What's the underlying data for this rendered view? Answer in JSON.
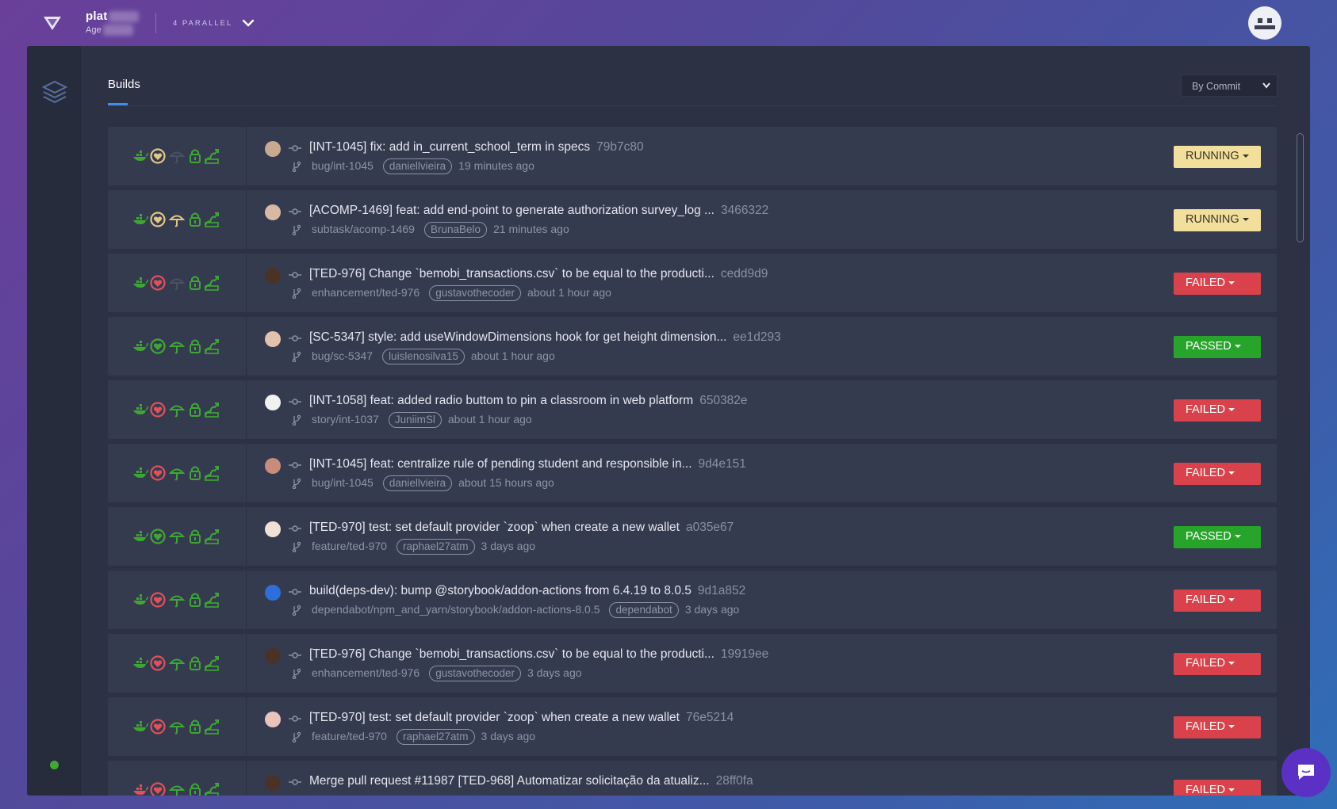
{
  "project": {
    "name": "plat",
    "subtitle": "Age",
    "parallel": "4 PARALLEL"
  },
  "tabs": {
    "builds": "Builds"
  },
  "sort": {
    "selected": "By Commit"
  },
  "colors": {
    "running": "#f2df9c",
    "failed": "#d9424a",
    "passed": "#27a52a",
    "icon_ok": "#3ea734",
    "icon_fail": "#e0515a",
    "icon_pending": "#e0c784"
  },
  "builds": [
    {
      "title": "[INT-1045] fix: add in_current_school_term in specs",
      "sha": "79b7c80",
      "branch": "bug/int-1045",
      "user": "daniellvieira",
      "time": "19 minutes ago",
      "status": "RUNNING",
      "icons": [
        "ok",
        "pending",
        "dim",
        "ok",
        "ok"
      ]
    },
    {
      "title": "[ACOMP-1469] feat: add end-point to generate authorization survey_log ...",
      "sha": "3466322",
      "branch": "subtask/acomp-1469",
      "user": "BrunaBelo",
      "time": "21 minutes ago",
      "status": "RUNNING",
      "icons": [
        "ok",
        "pending",
        "pending",
        "ok",
        "ok"
      ]
    },
    {
      "title": "[TED-976] Change `bemobi_transactions.csv` to be equal to the producti...",
      "sha": "cedd9d9",
      "branch": "enhancement/ted-976",
      "user": "gustavothecoder",
      "time": "about 1 hour ago",
      "status": "FAILED",
      "icons": [
        "ok",
        "fail",
        "dim",
        "ok",
        "ok"
      ]
    },
    {
      "title": "[SC-5347] style: add useWindowDimensions hook for get height dimension...",
      "sha": "ee1d293",
      "branch": "bug/sc-5347",
      "user": "luislenosilva15",
      "time": "about 1 hour ago",
      "status": "PASSED",
      "icons": [
        "ok",
        "ok",
        "ok",
        "ok",
        "ok"
      ]
    },
    {
      "title": "[INT-1058] feat: added radio buttom to pin a classroom in web platform",
      "sha": "650382e",
      "branch": "story/int-1037",
      "user": "JuniimSl",
      "time": "about 1 hour ago",
      "status": "FAILED",
      "icons": [
        "ok",
        "fail",
        "ok",
        "ok",
        "ok"
      ]
    },
    {
      "title": "[INT-1045] feat: centralize rule of pending student and responsible in...",
      "sha": "9d4e151",
      "branch": "bug/int-1045",
      "user": "daniellvieira",
      "time": "about 15 hours ago",
      "status": "FAILED",
      "icons": [
        "ok",
        "fail",
        "ok",
        "ok",
        "ok"
      ]
    },
    {
      "title": "[TED-970] test: set default provider `zoop` when create a new wallet",
      "sha": "a035e67",
      "branch": "feature/ted-970",
      "user": "raphael27atm",
      "time": "3 days ago",
      "status": "PASSED",
      "icons": [
        "ok",
        "ok",
        "ok",
        "ok",
        "ok"
      ]
    },
    {
      "title": "build(deps-dev): bump @storybook/addon-actions from 6.4.19 to 8.0.5",
      "sha": "9d1a852",
      "branch": "dependabot/npm_and_yarn/storybook/addon-actions-8.0.5",
      "user": "dependabot",
      "time": "3 days ago",
      "status": "FAILED",
      "icons": [
        "ok",
        "fail",
        "ok",
        "ok",
        "ok"
      ]
    },
    {
      "title": "[TED-976] Change `bemobi_transactions.csv` to be equal to the producti...",
      "sha": "19919ee",
      "branch": "enhancement/ted-976",
      "user": "gustavothecoder",
      "time": "3 days ago",
      "status": "FAILED",
      "icons": [
        "ok",
        "fail",
        "ok",
        "ok",
        "ok"
      ]
    },
    {
      "title": "[TED-970] test: set default provider `zoop` when create a new wallet",
      "sha": "76e5214",
      "branch": "feature/ted-970",
      "user": "raphael27atm",
      "time": "3 days ago",
      "status": "FAILED",
      "icons": [
        "ok",
        "fail",
        "ok",
        "ok",
        "ok"
      ]
    },
    {
      "title": "Merge pull request #11987 [TED-968] Automatizar solicitação da atualiz...",
      "sha": "28ff0fa",
      "branch": "",
      "user": "",
      "time": "",
      "status": "FAILED",
      "icons": [
        "fail",
        "fail",
        "ok",
        "ok",
        "ok"
      ]
    }
  ]
}
